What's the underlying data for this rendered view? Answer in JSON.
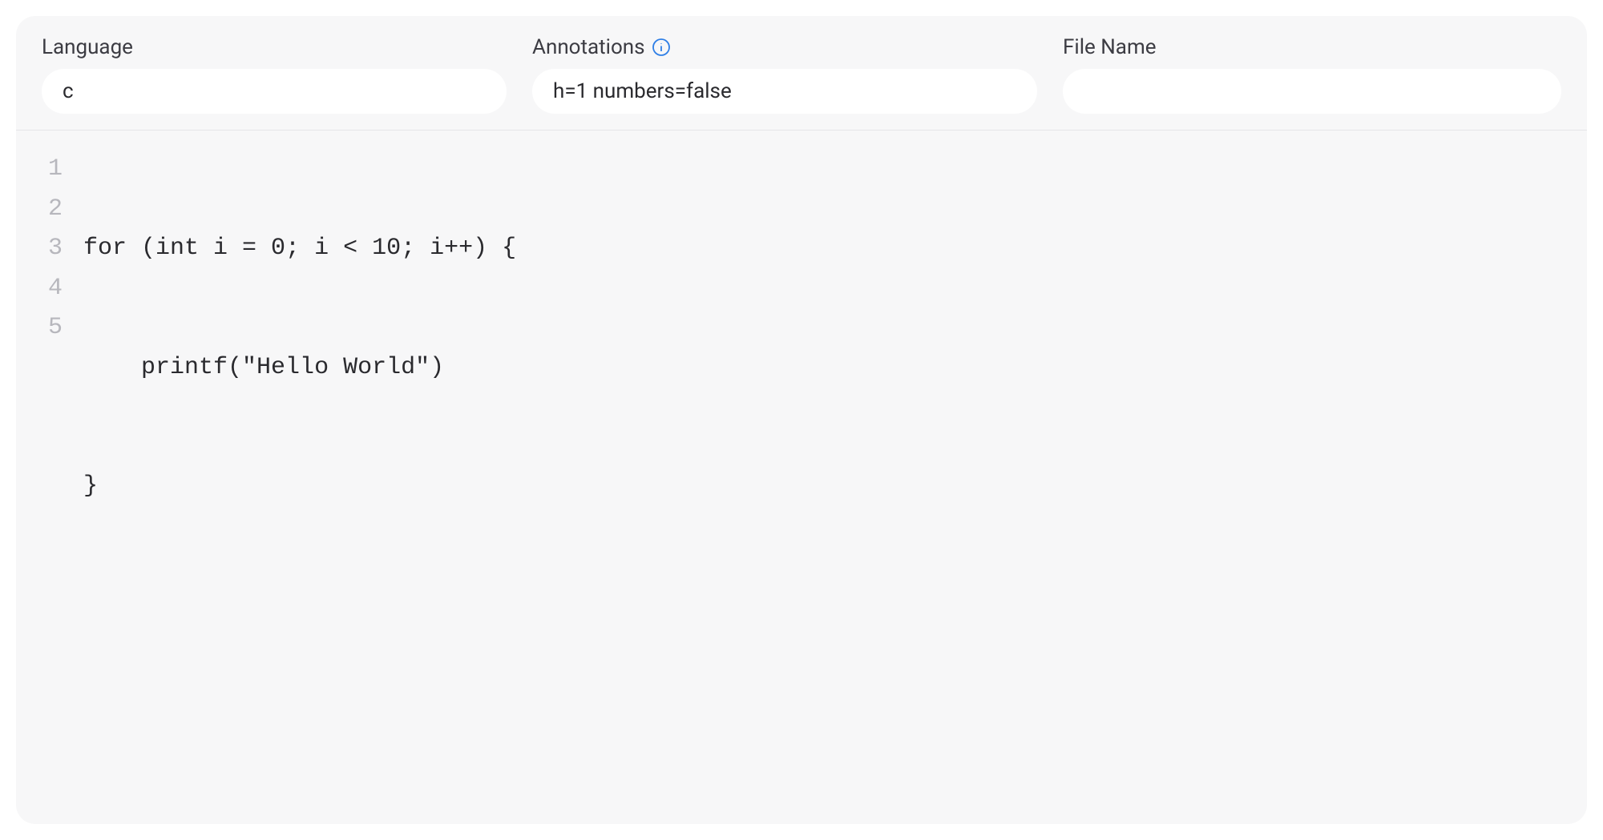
{
  "fields": {
    "language": {
      "label": "Language",
      "value": "c"
    },
    "annotations": {
      "label": "Annotations",
      "value": "h=1 numbers=false"
    },
    "filename": {
      "label": "File Name",
      "value": ""
    }
  },
  "code": {
    "line_numbers": [
      "1",
      "2",
      "3",
      "4",
      "5"
    ],
    "lines": [
      "for (int i = 0; i < 10; i++) {",
      "    printf(\"Hello World\")",
      "}",
      "",
      ""
    ]
  }
}
